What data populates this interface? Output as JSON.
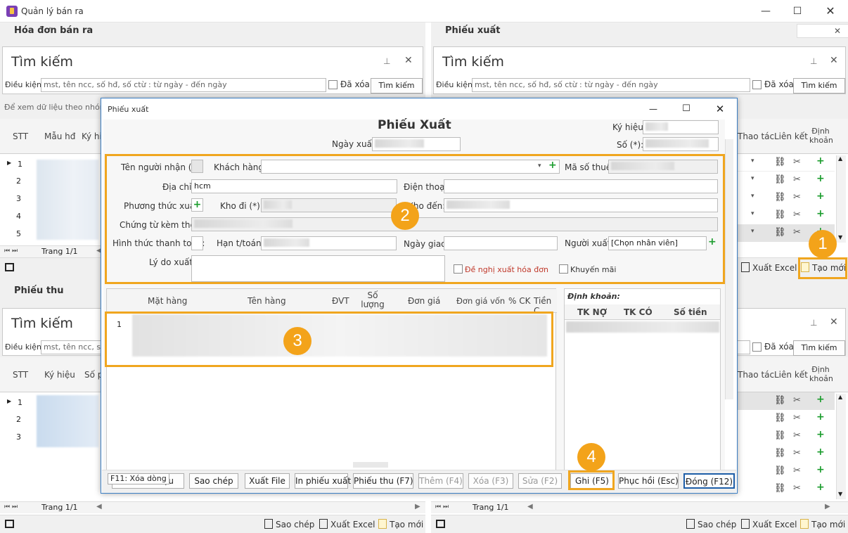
{
  "app": {
    "title": "Quản lý bán ra"
  },
  "left_top": {
    "title": "Hóa đơn bán ra",
    "search_title": "Tìm kiếm",
    "filter_label": "Điều kiện:",
    "filter_placeholder": "mst, tên ncc, số hđ, số ctừ : từ ngày - đến ngày",
    "deleted_label": "Đã xóa",
    "search_button": "Tìm kiếm",
    "group_hint": "Để xem dữ liệu theo nhóm: K",
    "columns": [
      "STT",
      "Mẫu hđ",
      "Ký hiệ"
    ],
    "rows": [
      "1",
      "2",
      "3",
      "4",
      "5"
    ],
    "page": "Trang 1/1"
  },
  "right_top": {
    "title": "Phiếu xuất",
    "search_title": "Tìm kiếm",
    "filter_label": "Điều kiện:",
    "filter_placeholder": "mst, tên ncc, số hđ, số ctừ : từ ngày - đến ngày",
    "deleted_label": "Đã xóa",
    "search_button": "Tìm kiếm",
    "columns": [
      "Thao tác",
      "Liên kết",
      "Định khoản"
    ],
    "toolbar": {
      "export_excel": "Xuất Excel",
      "create_new": "Tạo mới"
    }
  },
  "left_bottom": {
    "title": "Phiếu thu",
    "search_title": "Tìm kiếm",
    "filter_label": "Điều kiện:",
    "filter_placeholder": "mst, tên ncc, số hđ, số ctừ : từ ngày - đến ngày",
    "columns": [
      "STT",
      "Ký hiệu",
      "Số ph"
    ],
    "rows": [
      "1",
      "2",
      "3"
    ],
    "page": "Trang 1/1",
    "toolbar": {
      "copy": "Sao chép",
      "export_excel": "Xuất Excel",
      "create_new": "Tạo mới"
    }
  },
  "right_bottom": {
    "deleted_label": "Đã xóa",
    "search_button": "Tìm kiếm",
    "columns": [
      "Thao tác",
      "Liên kết",
      "Định khoản"
    ],
    "page": "Trang 1/1",
    "toolbar": {
      "copy": "Sao chép",
      "export_excel": "Xuất Excel",
      "create_new": "Tạo mới"
    }
  },
  "dialog": {
    "window_title": "Phiếu xuất",
    "heading": "Phiếu Xuất",
    "export_date_label": "Ngày xuất:",
    "symbol_label": "Ký hiệu:",
    "number_label": "Số (*):",
    "recipient_label": "Tên người nhận (*):",
    "customer_label": "Khách hàng:",
    "tax_code_label": "Mã số thuế:",
    "address_label": "Địa chỉ:",
    "address_value": "hcm",
    "phone_label": "Điện thoại:",
    "method_label": "Phương thức xuất:",
    "from_store_label": "Kho đi (*):",
    "to_store_label": "Kho đến:",
    "attached_label": "Chứng từ kèm theo:",
    "payment_form_label": "Hình thức thanh toán:",
    "due_label": "Hạn t/toán:",
    "delivery_date_label": "Ngày giao:",
    "exporter_label": "Người xuất:",
    "exporter_value": "[Chọn nhân viên]",
    "reason_label": "Lý do xuất:",
    "invoice_request_label": "Đề nghị xuất hóa đơn",
    "promotion_label": "Khuyến mãi",
    "grid_columns": [
      "Mặt hàng",
      "Tên hàng",
      "ĐVT",
      "Số lượng",
      "Đơn giá",
      "Đơn giá vốn",
      "% CK",
      "Tiền C"
    ],
    "grid_row": "1",
    "posting_title": "Định khoản:",
    "posting_columns": [
      "TK NỢ",
      "TK CÓ",
      "Số tiền"
    ],
    "buttons": {
      "delete_row": "F11: Xóa dòng",
      "data": "liệu",
      "copy": "Sao chép",
      "export_file": "Xuất File",
      "print": "In phiếu xuất",
      "receipt": "Phiếu thu   (F7)",
      "add": "Thêm   (F4)",
      "delete": "Xóa   (F3)",
      "edit": "Sửa   (F2)",
      "save": "Ghi   (F5)",
      "restore": "Phục hồi   (Esc)",
      "close": "Đóng   (F12)"
    }
  },
  "badges": [
    "1",
    "2",
    "3",
    "4"
  ]
}
